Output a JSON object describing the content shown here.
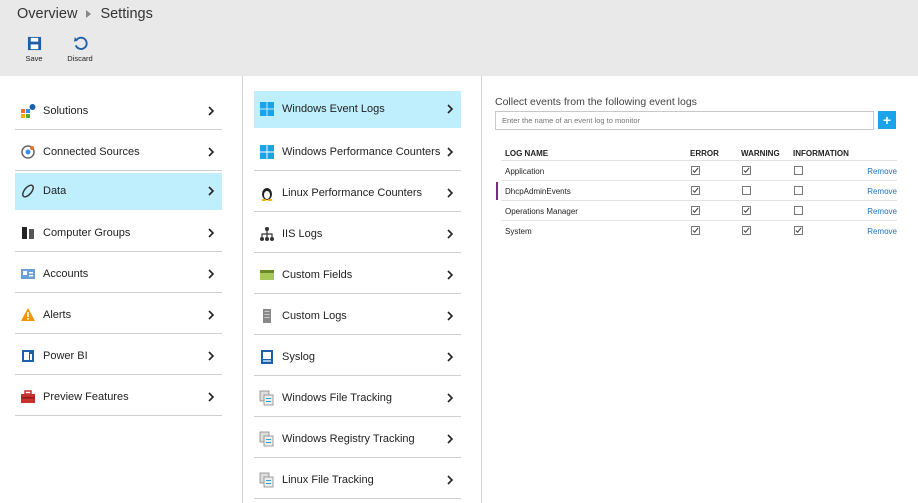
{
  "breadcrumb": {
    "overview": "Overview",
    "settings": "Settings"
  },
  "toolbar": {
    "save": "Save",
    "discard": "Discard"
  },
  "nav": [
    {
      "label": "Solutions",
      "icon": "solutions-icon"
    },
    {
      "label": "Connected Sources",
      "icon": "connected-sources-icon"
    },
    {
      "label": "Data",
      "icon": "data-icon",
      "active": true
    },
    {
      "label": "Computer Groups",
      "icon": "computer-groups-icon"
    },
    {
      "label": "Accounts",
      "icon": "accounts-icon"
    },
    {
      "label": "Alerts",
      "icon": "alert-icon"
    },
    {
      "label": "Power BI",
      "icon": "power-bi-icon"
    },
    {
      "label": "Preview Features",
      "icon": "toolbox-icon"
    }
  ],
  "datanav": [
    {
      "label": "Windows Event Logs",
      "icon": "windows-icon",
      "active": true
    },
    {
      "label": "Windows Performance Counters",
      "icon": "windows-icon"
    },
    {
      "label": "Linux Performance Counters",
      "icon": "linux-icon"
    },
    {
      "label": "IIS Logs",
      "icon": "network-icon"
    },
    {
      "label": "Custom Fields",
      "icon": "custom-fields-icon"
    },
    {
      "label": "Custom Logs",
      "icon": "custom-logs-icon"
    },
    {
      "label": "Syslog",
      "icon": "syslog-icon"
    },
    {
      "label": "Windows File Tracking",
      "icon": "file-tracking-icon"
    },
    {
      "label": "Windows Registry Tracking",
      "icon": "registry-tracking-icon"
    },
    {
      "label": "Linux File Tracking",
      "icon": "file-tracking-icon"
    }
  ],
  "panel": {
    "title": "Collect events from the following event logs",
    "placeholder": "Enter the name of an event log to monitor",
    "add": "+",
    "columns": [
      "LOG NAME",
      "ERROR",
      "WARNING",
      "INFORMATION"
    ],
    "remove": "Remove",
    "rows": [
      {
        "name": "Application",
        "error": true,
        "warning": true,
        "information": false
      },
      {
        "name": "DhcpAdminEvents",
        "error": true,
        "warning": false,
        "information": false,
        "marked": true
      },
      {
        "name": "Operations Manager",
        "error": true,
        "warning": true,
        "information": false
      },
      {
        "name": "System",
        "error": true,
        "warning": true,
        "information": true
      }
    ]
  },
  "colors": {
    "active_bg": "#bfeefd",
    "accent": "#1aa3e8",
    "link": "#1a73c8",
    "header_bg": "#e9e9e9"
  }
}
